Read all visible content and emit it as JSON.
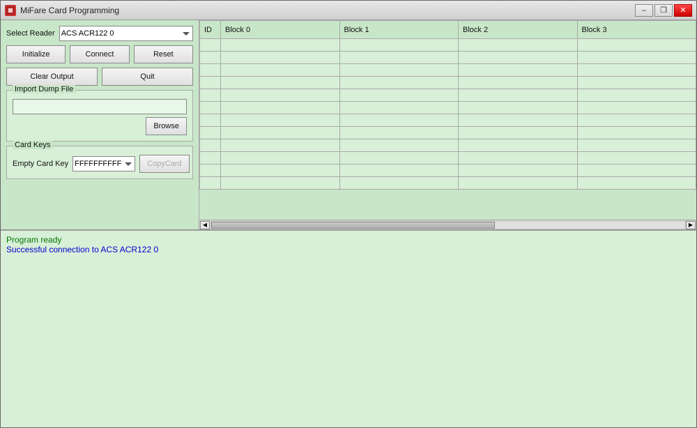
{
  "window": {
    "title": "MiFare Card Programming",
    "icon_label": "app-icon"
  },
  "title_bar": {
    "title": "MiFare Card Programming",
    "minimize_label": "–",
    "restore_label": "❒",
    "close_label": "✕"
  },
  "left_panel": {
    "select_reader_label": "Select Reader",
    "reader_options": [
      "ACS ACR122 0"
    ],
    "reader_value": "ACS ACR122 0",
    "buttons": {
      "initialize": "Initialize",
      "connect": "Connect",
      "reset": "Reset",
      "clear_output": "Clear Output",
      "quit": "Quit"
    },
    "import_dump_file": {
      "group_title": "Import Dump File",
      "file_input_placeholder": "",
      "browse_label": "Browse"
    },
    "card_keys": {
      "group_title": "Card Keys",
      "empty_card_key_label": "Empty Card Key",
      "key_options": [
        "FFFFFFFFFFFF"
      ],
      "key_value": "FFFFFFFFFFFF",
      "copy_card_label": "CopyCard"
    }
  },
  "table": {
    "columns": [
      "ID",
      "Block 0",
      "Block 1",
      "Block 2",
      "Block 3"
    ],
    "rows": [
      [
        "",
        "",
        "",
        "",
        ""
      ],
      [
        "",
        "",
        "",
        "",
        ""
      ],
      [
        "",
        "",
        "",
        "",
        ""
      ],
      [
        "",
        "",
        "",
        "",
        ""
      ],
      [
        "",
        "",
        "",
        "",
        ""
      ],
      [
        "",
        "",
        "",
        "",
        ""
      ],
      [
        "",
        "",
        "",
        "",
        ""
      ],
      [
        "",
        "",
        "",
        "",
        ""
      ],
      [
        "",
        "",
        "",
        "",
        ""
      ],
      [
        "",
        "",
        "",
        "",
        ""
      ],
      [
        "",
        "",
        "",
        "",
        ""
      ],
      [
        "",
        "",
        "",
        "",
        ""
      ]
    ]
  },
  "output": {
    "lines": [
      {
        "text": "Program ready",
        "style": "green"
      },
      {
        "text": "Successful connection to ACS ACR122 0",
        "style": "blue"
      }
    ]
  }
}
